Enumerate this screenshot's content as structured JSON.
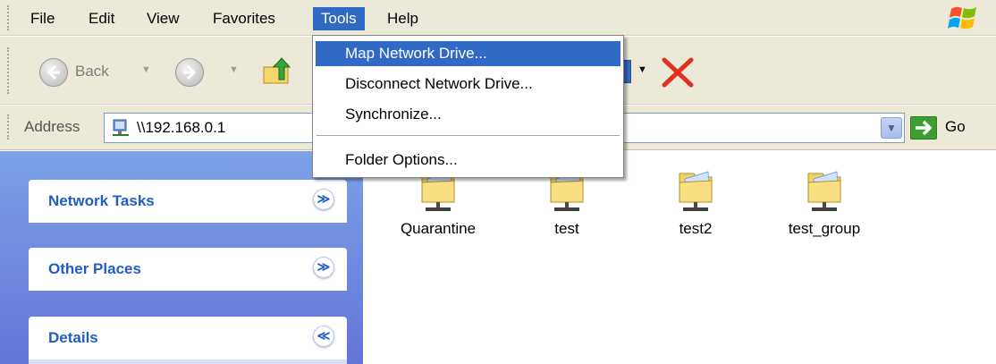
{
  "menubar": {
    "items": [
      "File",
      "Edit",
      "View",
      "Favorites",
      "Tools",
      "Help"
    ],
    "active": "Tools"
  },
  "toolbar": {
    "back_label": "Back"
  },
  "address": {
    "label": "Address",
    "value": "\\\\192.168.0.1",
    "go_label": "Go"
  },
  "tools_menu": {
    "items": [
      "Map Network Drive...",
      "Disconnect Network Drive...",
      "Synchronize...",
      "Folder Options..."
    ],
    "highlighted": "Map Network Drive..."
  },
  "task_pane": {
    "panels": [
      {
        "title": "Network Tasks",
        "state": "collapsed",
        "icon": "chevron-double-down-icon"
      },
      {
        "title": "Other Places",
        "state": "collapsed",
        "icon": "chevron-double-down-icon"
      },
      {
        "title": "Details",
        "state": "expanded",
        "icon": "chevron-double-up-icon"
      }
    ]
  },
  "shares": [
    "Quarantine",
    "test",
    "test2",
    "test_group"
  ],
  "colors": {
    "menu_highlight": "#316ac5",
    "task_pane_bg": "#6b8ee0",
    "task_title": "#215dc6",
    "chrome_bg": "#ece9d8"
  }
}
